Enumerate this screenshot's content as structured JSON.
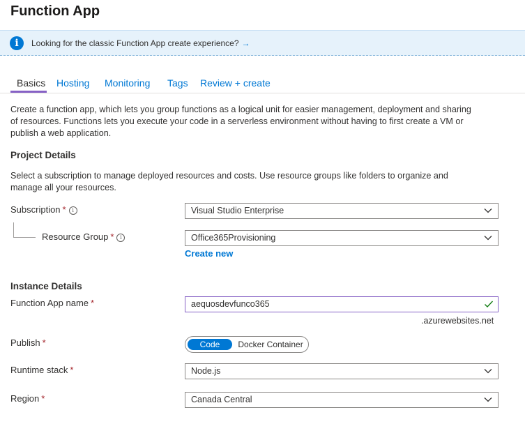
{
  "page": {
    "title": "Function App"
  },
  "banner": {
    "text": "Looking for the classic Function App create experience?",
    "arrow": "→",
    "icon": "info-icon"
  },
  "tabs": [
    {
      "label": "Basics",
      "active": true
    },
    {
      "label": "Hosting"
    },
    {
      "label": "Monitoring"
    },
    {
      "label": "Tags"
    },
    {
      "label": "Review + create"
    }
  ],
  "intro": {
    "line1": "Create a function app, which lets you group functions as a logical unit for easier management, deployment and sharing",
    "line2": "of resources. Functions lets you execute your code in a serverless environment without having to first create a VM or",
    "line3": "publish a web application."
  },
  "project": {
    "heading": "Project Details",
    "desc1": "Select a subscription to manage deployed resources and costs. Use resource groups like folders to organize and",
    "desc2": "manage all your resources.",
    "subscription": {
      "label": "Subscription",
      "required": "*",
      "value": "Visual Studio Enterprise"
    },
    "resource_group": {
      "label": "Resource Group",
      "required": "*",
      "value": "Office365Provisioning",
      "create_new": "Create new"
    }
  },
  "instance": {
    "heading": "Instance Details",
    "name": {
      "label": "Function App name",
      "required": "*",
      "value": "aequosdevfunco365",
      "suffix": ".azurewebsites.net"
    },
    "publish": {
      "label": "Publish",
      "required": "*",
      "options": [
        "Code",
        "Docker Container"
      ],
      "selected": "Code"
    },
    "runtime": {
      "label": "Runtime stack",
      "required": "*",
      "value": "Node.js"
    },
    "region": {
      "label": "Region",
      "required": "*",
      "value": "Canada Central"
    }
  },
  "colors": {
    "accent": "#0078d4",
    "tab_underline": "#8661c5",
    "required": "#a4262c",
    "valid": "#107c10"
  }
}
